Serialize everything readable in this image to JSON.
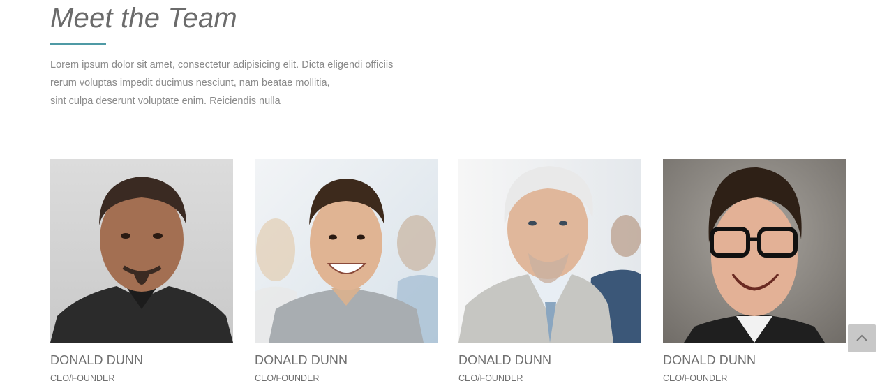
{
  "section": {
    "title": "Meet the Team",
    "intro_lines": [
      "Lorem ipsum dolor sit amet, consectetur adipisicing elit. Dicta eligendi officiis",
      "rerum voluptas impedit ducimus nesciunt, nam beatae mollitia,",
      "sint culpa deserunt voluptate enim. Reiciendis nulla"
    ],
    "accent_color": "#4f9aa5"
  },
  "team": [
    {
      "name": "DONALD DUNN",
      "role": "CEO/FOUNDER"
    },
    {
      "name": "DONALD DUNN",
      "role": "CEO/FOUNDER"
    },
    {
      "name": "DONALD DUNN",
      "role": "CEO/FOUNDER"
    },
    {
      "name": "DONALD DUNN",
      "role": "CEO/FOUNDER"
    }
  ],
  "back_to_top": {
    "icon": "chevron-up-icon"
  }
}
